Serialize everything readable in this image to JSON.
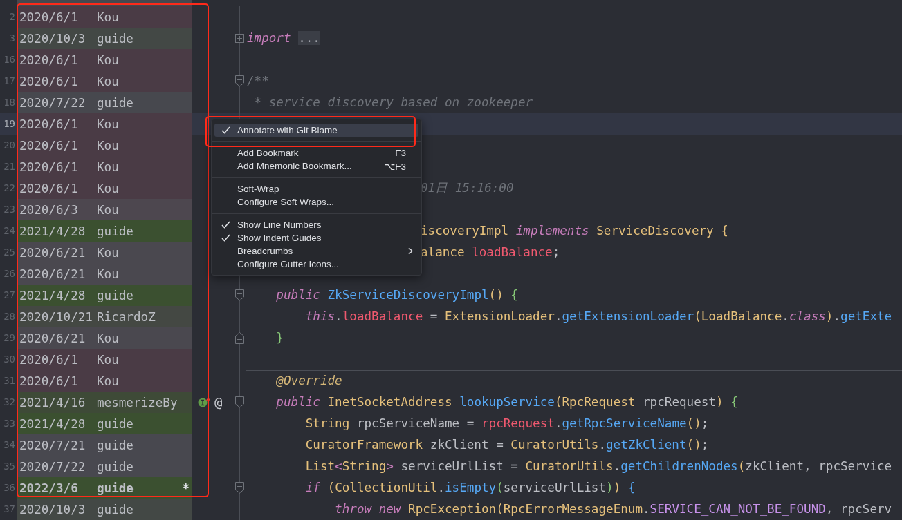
{
  "blame": {
    "framed": true
  },
  "lines": [
    {
      "number": "2",
      "date": "2020/6/1",
      "author": "Kou",
      "color": "#4a3b45",
      "current": false
    },
    {
      "number": "3",
      "date": "2020/10/3",
      "author": "guide",
      "color": "#434845",
      "current": false,
      "folded": true,
      "code": [
        {
          "kind": "keyword",
          "text": "import "
        },
        {
          "kind": "folded",
          "text": "..."
        }
      ]
    },
    {
      "number": "16",
      "date": "2020/6/1",
      "author": "Kou",
      "color": "#4a3b45",
      "current": false
    },
    {
      "number": "17",
      "date": "2020/6/1",
      "author": "Kou",
      "color": "#4a3b45",
      "current": false,
      "fold_start": true,
      "code": [
        {
          "kind": "comment",
          "text": "/**"
        }
      ]
    },
    {
      "number": "18",
      "date": "2020/7/22",
      "author": "guide",
      "color": "#47484e",
      "current": false,
      "code": [
        {
          "kind": "comment",
          "text": " * service discovery based on zookeeper"
        }
      ]
    },
    {
      "number": "19",
      "date": "2020/6/1",
      "author": "Kou",
      "color": "#4a3b45",
      "current": true
    },
    {
      "number": "20",
      "date": "2020/6/1",
      "author": "Kou",
      "color": "#4a3b45",
      "current": false
    },
    {
      "number": "21",
      "date": "2020/6/1",
      "author": "Kou",
      "color": "#4a3b45",
      "current": false
    },
    {
      "number": "22",
      "date": "2020/6/1",
      "author": "Kou",
      "color": "#4a3b45",
      "current": false,
      "covered": true,
      "code": [
        {
          "kind": "comment",
          "text": "01日 15:16:00"
        }
      ]
    },
    {
      "number": "23",
      "date": "2020/6/3",
      "author": "Kou",
      "color": "#4d474f",
      "current": false
    },
    {
      "number": "24",
      "date": "2021/4/28",
      "author": "guide",
      "color": "#3b5030",
      "current": false,
      "covered": true,
      "code": [
        {
          "kind": "type",
          "text": "iscoveryImpl "
        },
        {
          "kind": "keyword",
          "text": "implements"
        },
        {
          "kind": "type",
          "text": " ServiceDiscovery "
        },
        {
          "kind": "bracket1",
          "text": "{"
        }
      ]
    },
    {
      "number": "25",
      "date": "2020/6/21",
      "author": "Kou",
      "color": "#4a484f",
      "current": false,
      "covered": true,
      "code": [
        {
          "kind": "type",
          "text": "alance "
        },
        {
          "kind": "field",
          "text": "loadBalance"
        },
        {
          "kind": "plain",
          "text": ";"
        }
      ]
    },
    {
      "number": "26",
      "date": "2020/6/21",
      "author": "Kou",
      "color": "#4a484f",
      "current": false
    },
    {
      "number": "27",
      "date": "2021/4/28",
      "author": "guide",
      "color": "#3b5030",
      "current": false,
      "fold_start": true,
      "separator": true,
      "code": [
        {
          "kind": "keyword",
          "text": "    public "
        },
        {
          "kind": "method",
          "text": "ZkServiceDiscoveryImpl"
        },
        {
          "kind": "bracket1",
          "text": "() "
        },
        {
          "kind": "bracket2",
          "text": "{"
        }
      ]
    },
    {
      "number": "28",
      "date": "2020/10/21",
      "author": "RicardoZ",
      "color": "#444843",
      "current": false,
      "code": [
        {
          "kind": "keyword",
          "text": "        this"
        },
        {
          "kind": "plain",
          "text": "."
        },
        {
          "kind": "field",
          "text": "loadBalance"
        },
        {
          "kind": "plain",
          "text": " = "
        },
        {
          "kind": "type",
          "text": "ExtensionLoader"
        },
        {
          "kind": "plain",
          "text": "."
        },
        {
          "kind": "method",
          "text": "getExtensionLoader"
        },
        {
          "kind": "bracket1",
          "text": "("
        },
        {
          "kind": "type",
          "text": "LoadBalance"
        },
        {
          "kind": "plain",
          "text": "."
        },
        {
          "kind": "keyword",
          "text": "class"
        },
        {
          "kind": "bracket1",
          "text": ")"
        },
        {
          "kind": "plain",
          "text": "."
        },
        {
          "kind": "method",
          "text": "getExte"
        }
      ]
    },
    {
      "number": "29",
      "date": "2020/6/21",
      "author": "Kou",
      "color": "#4a484f",
      "current": false,
      "fold_end": true,
      "code": [
        {
          "kind": "bracket2",
          "text": "    }"
        }
      ]
    },
    {
      "number": "30",
      "date": "2020/6/1",
      "author": "Kou",
      "color": "#4a3b45",
      "current": false
    },
    {
      "number": "31",
      "date": "2020/6/1",
      "author": "Kou",
      "color": "#4a3b45",
      "current": false,
      "separator": true,
      "code": [
        {
          "kind": "annotation",
          "text": "    @Override"
        }
      ]
    },
    {
      "number": "32",
      "date": "2021/4/16",
      "author": "mesmerizeBy",
      "color": "#3e4a37",
      "current": false,
      "fold_start": true,
      "change_marker": true,
      "gutter_text": "@",
      "code": [
        {
          "kind": "keyword",
          "text": "    public "
        },
        {
          "kind": "type",
          "text": "InetSocketAddress "
        },
        {
          "kind": "method",
          "text": "lookupService"
        },
        {
          "kind": "bracket1",
          "text": "("
        },
        {
          "kind": "type",
          "text": "RpcRequest"
        },
        {
          "kind": "plain",
          "text": " rpcRequest"
        },
        {
          "kind": "bracket1",
          "text": ") "
        },
        {
          "kind": "bracket2",
          "text": "{"
        }
      ]
    },
    {
      "number": "33",
      "date": "2021/4/28",
      "author": "guide",
      "color": "#3b5030",
      "current": false,
      "code": [
        {
          "kind": "type",
          "text": "        String"
        },
        {
          "kind": "plain",
          "text": " rpcServiceName = "
        },
        {
          "kind": "field",
          "text": "rpcRequest"
        },
        {
          "kind": "plain",
          "text": "."
        },
        {
          "kind": "method",
          "text": "getRpcServiceName"
        },
        {
          "kind": "bracket1",
          "text": "()"
        },
        {
          "kind": "plain",
          "text": ";"
        }
      ]
    },
    {
      "number": "34",
      "date": "2020/7/21",
      "author": "guide",
      "color": "#48484f",
      "current": false,
      "code": [
        {
          "kind": "type",
          "text": "        CuratorFramework"
        },
        {
          "kind": "plain",
          "text": " zkClient = "
        },
        {
          "kind": "type",
          "text": "CuratorUtils"
        },
        {
          "kind": "plain",
          "text": "."
        },
        {
          "kind": "method",
          "text": "getZkClient"
        },
        {
          "kind": "bracket1",
          "text": "()"
        },
        {
          "kind": "plain",
          "text": ";"
        }
      ]
    },
    {
      "number": "35",
      "date": "2020/7/22",
      "author": "guide",
      "color": "#48484f",
      "current": false,
      "code": [
        {
          "kind": "type",
          "text": "        List"
        },
        {
          "kind": "generic",
          "text": "<"
        },
        {
          "kind": "type",
          "text": "String"
        },
        {
          "kind": "generic",
          "text": ">"
        },
        {
          "kind": "plain",
          "text": " serviceUrlList = "
        },
        {
          "kind": "type",
          "text": "CuratorUtils"
        },
        {
          "kind": "plain",
          "text": "."
        },
        {
          "kind": "method",
          "text": "getChildrenNodes"
        },
        {
          "kind": "bracket1",
          "text": "("
        },
        {
          "kind": "plain",
          "text": "zkClient, rpcService"
        }
      ]
    },
    {
      "number": "36",
      "date": "2022/3/6",
      "author": "guide",
      "color": "#3b5030",
      "current": false,
      "modified": "*",
      "fold_start": true,
      "code": [
        {
          "kind": "keyword",
          "text": "        if "
        },
        {
          "kind": "bracket1",
          "text": "("
        },
        {
          "kind": "type",
          "text": "CollectionUtil"
        },
        {
          "kind": "plain",
          "text": "."
        },
        {
          "kind": "method",
          "text": "isEmpty"
        },
        {
          "kind": "bracket2",
          "text": "("
        },
        {
          "kind": "plain",
          "text": "serviceUrlList"
        },
        {
          "kind": "bracket2",
          "text": ")"
        },
        {
          "kind": "bracket1",
          "text": ") "
        },
        {
          "kind": "bracket3",
          "text": "{"
        }
      ]
    },
    {
      "number": "37",
      "date": "2020/10/3",
      "author": "guide",
      "color": "#434845",
      "current": false,
      "code": [
        {
          "kind": "keyword",
          "text": "            throw new "
        },
        {
          "kind": "type",
          "text": "RpcException"
        },
        {
          "kind": "bracket1",
          "text": "("
        },
        {
          "kind": "type",
          "text": "RpcErrorMessageEnum"
        },
        {
          "kind": "plain",
          "text": "."
        },
        {
          "kind": "constant",
          "text": "SERVICE_CAN_NOT_BE_FOUND"
        },
        {
          "kind": "plain",
          "text": ", rpcServ"
        }
      ]
    }
  ],
  "menu": {
    "groups": [
      [
        {
          "label": "Annotate with Git Blame",
          "checked": true,
          "selected": true,
          "framed": true
        }
      ],
      [
        {
          "label": "Add Bookmark",
          "checked": false,
          "selected": false,
          "shortcut": "F3"
        },
        {
          "label": "Add Mnemonic Bookmark...",
          "checked": false,
          "selected": false,
          "shortcut": "⌥F3"
        }
      ],
      [
        {
          "label": "Soft-Wrap",
          "checked": false,
          "selected": false
        },
        {
          "label": "Configure Soft Wraps...",
          "checked": false,
          "selected": false
        }
      ],
      [
        {
          "label": "Show Line Numbers",
          "checked": true,
          "selected": false
        },
        {
          "label": "Show Indent Guides",
          "checked": true,
          "selected": false
        },
        {
          "label": "Breadcrumbs",
          "checked": false,
          "selected": false,
          "submenu": true
        },
        {
          "label": "Configure Gutter Icons...",
          "checked": false,
          "selected": false
        }
      ]
    ]
  }
}
